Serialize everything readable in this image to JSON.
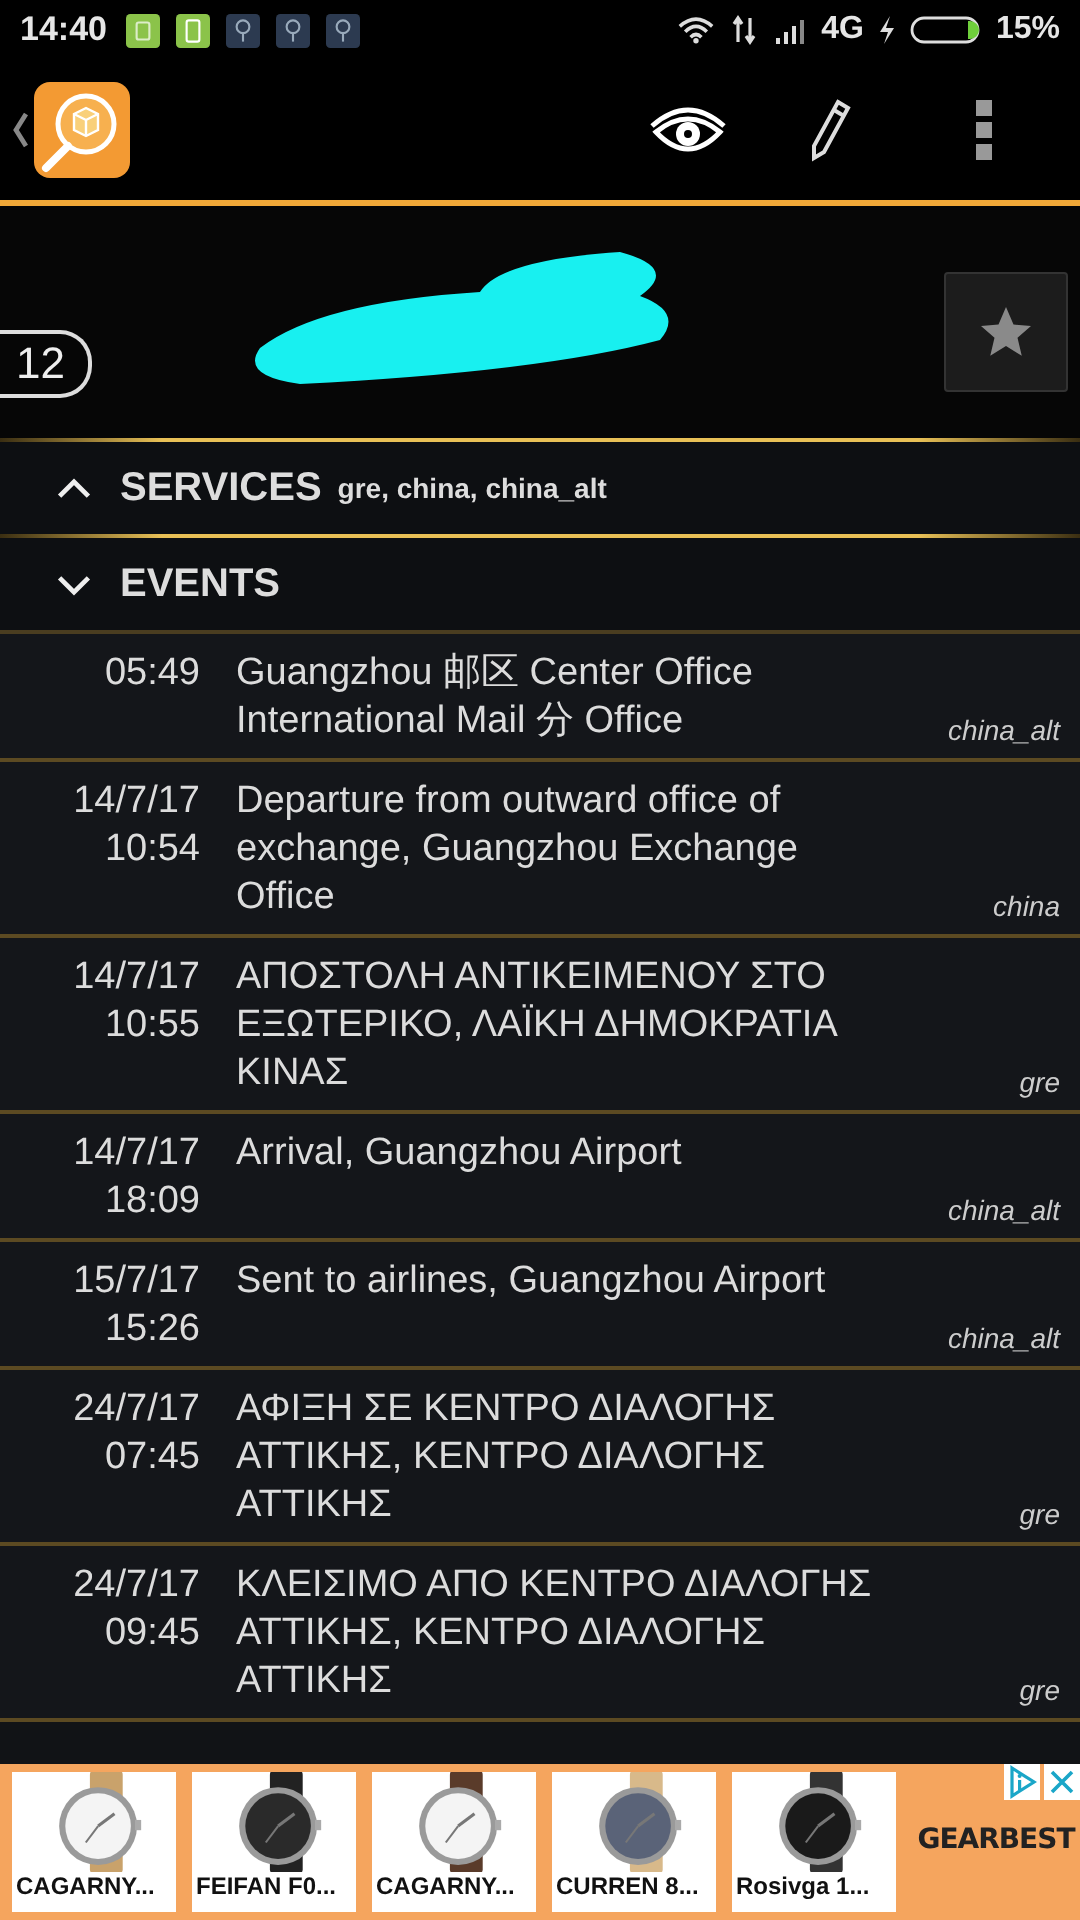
{
  "status_bar": {
    "time": "14:40",
    "network": "4G",
    "battery": "15%"
  },
  "header": {
    "count": "12",
    "starred": false
  },
  "sections": [
    {
      "title": "SERVICES",
      "detail": "gre, china, china_alt",
      "expanded": false
    },
    {
      "title": "EVENTS",
      "expanded": true
    }
  ],
  "events": [
    {
      "time": "05:49",
      "text": "Guangzhou 邮区 Center Office International Mail 分 Office",
      "service": "china_alt"
    },
    {
      "date": "14/7/17",
      "time": "10:54",
      "text": "Departure from outward office of exchange, Guangzhou Exchange Office",
      "service": "china"
    },
    {
      "date": "14/7/17",
      "time": "10:55",
      "text": "ΑΠΟΣΤΟΛΗ ΑΝΤΙΚΕΙΜΕΝΟΥ ΣΤΟ ΕΞΩΤΕΡΙΚΟ, ΛΑΪΚΗ ΔΗΜΟΚΡΑΤΙΑ ΚΙΝΑΣ",
      "service": "gre"
    },
    {
      "date": "14/7/17",
      "time": "18:09",
      "text": "Arrival, Guangzhou Airport",
      "service": "china_alt"
    },
    {
      "date": "15/7/17",
      "time": "15:26",
      "text": "Sent to airlines, Guangzhou Airport",
      "service": "china_alt"
    },
    {
      "date": "24/7/17",
      "time": "07:45",
      "text": "ΑΦΙΞΗ ΣΕ ΚΕΝΤΡΟ ΔΙΑΛΟΓΗΣ ΑΤΤΙΚΗΣ, ΚΕΝΤΡΟ ΔΙΑΛΟΓΗΣ ΑΤΤΙΚΗΣ",
      "service": "gre"
    },
    {
      "date": "24/7/17",
      "time": "09:45",
      "text": "ΚΛΕΙΣΙΜΟ ΑΠΟ ΚΕΝΤΡΟ ΔΙΑΛΟΓΗΣ ΑΤΤΙΚΗΣ, ΚΕΝΤΡΟ ΔΙΑΛΟΓΗΣ ΑΤΤΙΚΗΣ",
      "service": "gre"
    }
  ],
  "ad": {
    "products": [
      "CAGARNY...",
      "FEIFAN F0...",
      "CAGARNY...",
      "CURREN 8...",
      "Rosivga 1..."
    ],
    "brand": "GEARBEST"
  }
}
